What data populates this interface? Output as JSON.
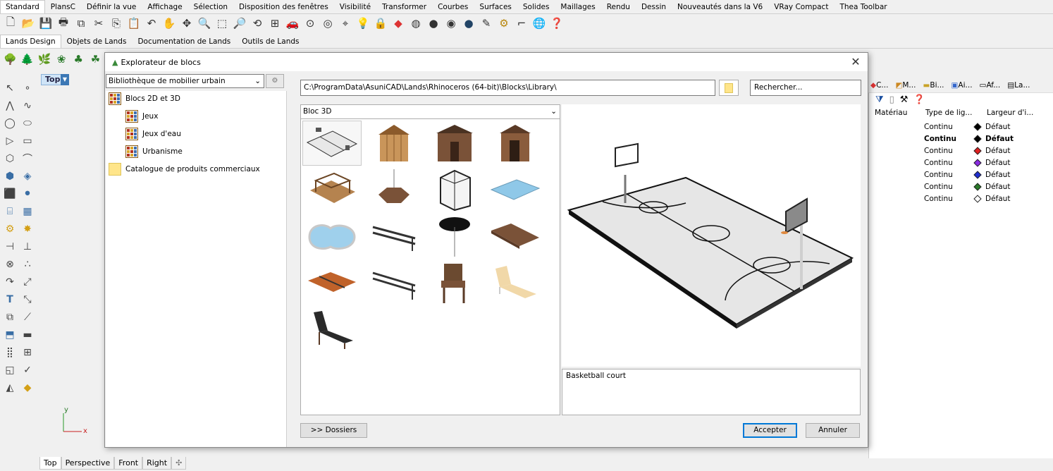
{
  "main_tabs": [
    "Standard",
    "PlansC",
    "Définir la vue",
    "Affichage",
    "Sélection",
    "Disposition des fenêtres",
    "Visibilité",
    "Transformer",
    "Courbes",
    "Surfaces",
    "Solides",
    "Maillages",
    "Rendu",
    "Dessin",
    "Nouveautés dans la V6",
    "VRay Compact",
    "Thea Toolbar"
  ],
  "lands_tabs": [
    "Lands Design",
    "Objets de Lands",
    "Documentation de Lands",
    "Outils de Lands"
  ],
  "viewport": {
    "label": "Top",
    "axis_x": "x",
    "axis_y": "y"
  },
  "viewport_tabs": [
    "Top",
    "Perspective",
    "Front",
    "Right"
  ],
  "right_panel": {
    "tabs": [
      "C...",
      "M...",
      "Bi...",
      "Ai...",
      "Af...",
      "La..."
    ],
    "headers": {
      "material": "Matériau",
      "linetype": "Type de lig...",
      "width": "Largeur d'i..."
    },
    "rows": [
      {
        "linetype": "Continu",
        "width": "Défaut",
        "color": "#000000",
        "bold": false
      },
      {
        "linetype": "Continu",
        "width": "Défaut",
        "color": "#000000",
        "bold": true
      },
      {
        "linetype": "Continu",
        "width": "Défaut",
        "color": "#e02020",
        "bold": false
      },
      {
        "linetype": "Continu",
        "width": "Défaut",
        "color": "#8a2be2",
        "bold": false
      },
      {
        "linetype": "Continu",
        "width": "Défaut",
        "color": "#1f2fd0",
        "bold": false
      },
      {
        "linetype": "Continu",
        "width": "Défaut",
        "color": "#2a7a2a",
        "bold": false
      },
      {
        "linetype": "Continu",
        "width": "Défaut",
        "color": "#ffffff",
        "bold": false
      }
    ]
  },
  "dialog": {
    "title": "Explorateur de blocs",
    "library_select": "Bibliothèque de mobilier urbain",
    "tree": {
      "root": "Blocs 2D et 3D",
      "children": [
        "Jeux",
        "Jeux d'eau",
        "Urbanisme"
      ],
      "catalog": "Catalogue de produits commerciaux"
    },
    "path": "C:\\ProgramData\\AsuniCAD\\Lands\\Rhinoceros (64-bit)\\Blocks\\Library\\",
    "search_placeholder": "Rechercher...",
    "block_type": "Bloc 3D",
    "description": "Basketball court",
    "folders_button": ">> Dossiers",
    "accept_button": "Accepter",
    "cancel_button": "Annuler"
  }
}
